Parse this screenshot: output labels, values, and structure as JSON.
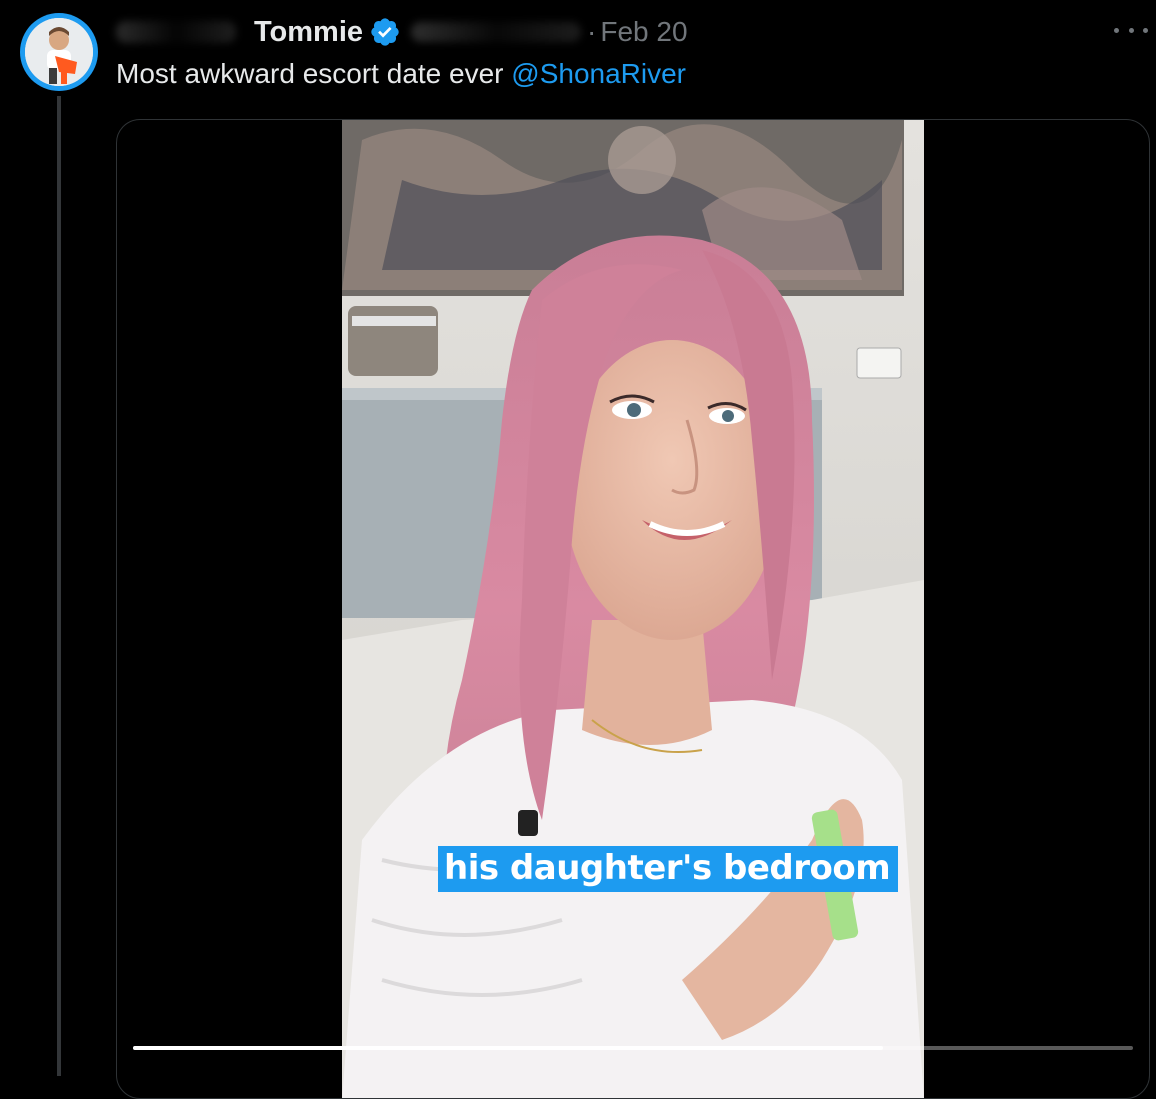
{
  "tweet": {
    "author": {
      "display_name": "Tommie",
      "verified": true,
      "avatar_icon": "avatar-icon"
    },
    "dot": "·",
    "date": "Feb 20",
    "text": "Most awkward escort date ever ",
    "mention": "@ShonaRiver",
    "more_icon": "more-icon"
  },
  "media": {
    "type": "video",
    "caption": "his daughter's bedroom",
    "progress": 0.75
  },
  "colors": {
    "accent": "#1d9bf0",
    "background": "#000000",
    "text": "#e7e9ea",
    "muted": "#71767b",
    "border": "#2f3336",
    "hair": "#d98aa2"
  }
}
